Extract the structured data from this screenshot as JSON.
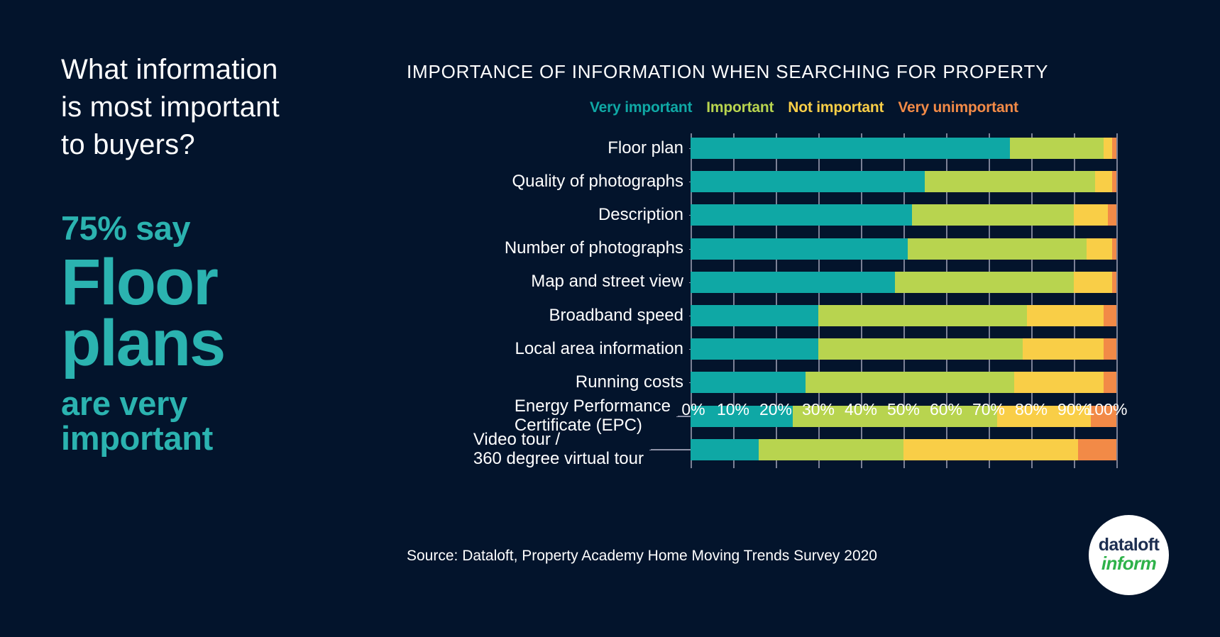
{
  "theme": {
    "background": "#03142c",
    "accent_teal": "#2bb3b0",
    "text_white": "#ffffff"
  },
  "left_panel": {
    "headline": "What information\nis most important\nto buyers?",
    "stat_percent": "75% say",
    "stat_big": "Floor\nplans",
    "stat_tail": "are very\nimportant"
  },
  "chart_panel": {
    "title": "IMPORTANCE OF INFORMATION WHEN SEARCHING FOR PROPERTY",
    "source": "Source: Dataloft, Property Academy Home Moving Trends Survey 2020"
  },
  "logo": {
    "top": "dataloft",
    "bottom": "inform",
    "top_color": "#1c2e50",
    "bottom_color": "#2eb24a"
  },
  "chart_data": {
    "type": "bar",
    "orientation": "horizontal",
    "stacked": true,
    "normalized_percent": true,
    "title": "IMPORTANCE OF INFORMATION WHEN SEARCHING FOR PROPERTY",
    "xlabel": "",
    "ylabel": "",
    "xlim": [
      0,
      100
    ],
    "xticks": [
      0,
      10,
      20,
      30,
      40,
      50,
      60,
      70,
      80,
      90,
      100
    ],
    "xtick_labels": [
      "0%",
      "10%",
      "20%",
      "30%",
      "40%",
      "50%",
      "60%",
      "70%",
      "80%",
      "90%",
      "100%"
    ],
    "grid": "vertical",
    "legend_position": "top",
    "categories": [
      "Floor plan",
      "Quality of photographs",
      "Description",
      "Number of photographs",
      "Map and street view",
      "Broadband speed",
      "Local area information",
      "Running costs",
      "Energy Performance\nCertificate (EPC)",
      "Video tour /\n360 degree virtual tour"
    ],
    "series": [
      {
        "name": "Very important",
        "color": "#0fa8a5",
        "values": [
          75,
          55,
          52,
          51,
          48,
          30,
          30,
          27,
          24,
          16
        ]
      },
      {
        "name": "Important",
        "color": "#b8d44f",
        "values": [
          22,
          40,
          38,
          42,
          42,
          49,
          48,
          49,
          48,
          34
        ]
      },
      {
        "name": "Not important",
        "color": "#f9ce47",
        "values": [
          2,
          4,
          8,
          6,
          9,
          18,
          19,
          21,
          22,
          41
        ]
      },
      {
        "name": "Very unimportant",
        "color": "#f28a47",
        "values": [
          1,
          1,
          2,
          1,
          1,
          3,
          3,
          3,
          6,
          9
        ]
      }
    ]
  }
}
